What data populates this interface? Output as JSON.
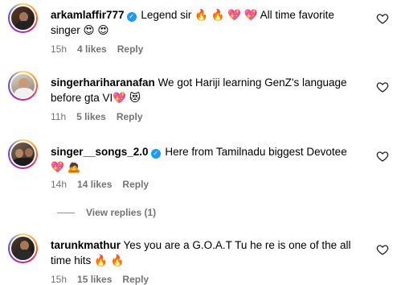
{
  "comments": [
    {
      "username": "arkamlaffir777",
      "verified": true,
      "text": "Legend sir 🔥 🔥 💖 💖  All time favorite singer 😍 😍",
      "time": "15h",
      "likes": "4 likes",
      "reply": "Reply"
    },
    {
      "username": "singerhariharanafan",
      "verified": false,
      "text": "We got Hariji learning GenZ's language before gta VI💖 😻",
      "time": "11h",
      "likes": "5 likes",
      "reply": "Reply"
    },
    {
      "username": "singer__songs_2.0",
      "verified": true,
      "text": "Here from Tamilnadu biggest Devotee 💖 🙇",
      "time": "14h",
      "likes": "14 likes",
      "reply": "Reply"
    },
    {
      "username": "tarunkmathur",
      "verified": false,
      "text": "Yes you are a G.O.A.T Tu he re is one of the all time hits 🔥 🔥",
      "time": "15h",
      "likes": "15 likes",
      "reply": "Reply"
    }
  ],
  "view_replies": "View replies (1)",
  "icons": {
    "like": "heart-outline-icon",
    "verified": "verified-badge-icon"
  }
}
